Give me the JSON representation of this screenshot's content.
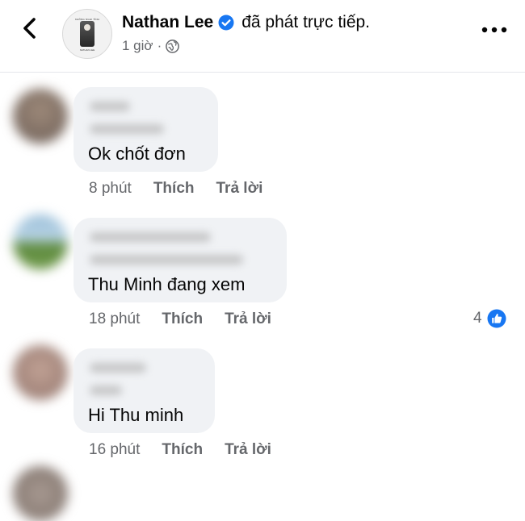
{
  "header": {
    "page_name": "Nathan Lee",
    "action": "đã phát trực tiếp.",
    "time": "1 giờ",
    "separator": "·",
    "avatar_top_text": "KHÔNG NGHI TÌNH",
    "avatar_bottom_text": "NATHAN LEE",
    "icons": {
      "back": "back-chevron-icon",
      "verified": "verified-badge-icon",
      "audience": "globe-icon",
      "more": "more-dots-icon"
    }
  },
  "comments": [
    {
      "text": "Ok chốt đơn",
      "time": "8 phút",
      "like_label": "Thích",
      "reply_label": "Trả lời"
    },
    {
      "text": "Thu Minh đang xem",
      "time": "18 phút",
      "like_label": "Thích",
      "reply_label": "Trả lời",
      "reaction_count": "4"
    },
    {
      "text": "Hi Thu minh",
      "time": "16 phút",
      "like_label": "Thích",
      "reply_label": "Trả lời"
    }
  ],
  "colors": {
    "accent": "#1877f2",
    "bubble": "#f0f2f5",
    "secondary_text": "#65676b"
  }
}
